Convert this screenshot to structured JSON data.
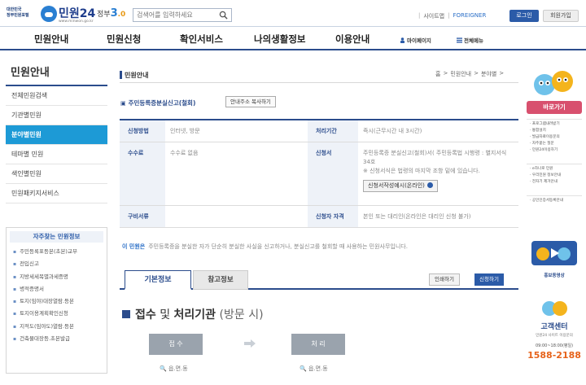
{
  "header": {
    "gov_logo_line1": "대한민국",
    "gov_logo_line2": "정부민원포털",
    "logo_text": "민원24",
    "logo_sub": "www.minwon.go.kr",
    "gov30_prefix": "정부",
    "gov30_num": "3",
    "gov30_suffix": ".0",
    "search_placeholder": "검색어를 입력하세요",
    "sitemap": "사이트맵",
    "foreigner": "FOREIGNER",
    "login": "로그인",
    "signup": "회원가입"
  },
  "gnb": {
    "items": [
      "민원안내",
      "민원신청",
      "확인서비스",
      "나의생활정보",
      "이용안내"
    ],
    "mypage": "마이페이지",
    "allmenu": "전체메뉴"
  },
  "lnb": {
    "title": "민원안내",
    "items": [
      "전체민원검색",
      "기관별민원",
      "분야별민원",
      "테마별 민원",
      "색인별민원",
      "민원패키지서비스"
    ]
  },
  "faq": {
    "title": "자주찾는 민원정보",
    "items": [
      "주민등록표등본(초본)교부",
      "전입신고",
      "지방세세목별과세증명",
      "병적증명서",
      "토지(임야)대장열람.등본",
      "토지이용계획확인신청",
      "지적도(임야도)열람.등본",
      "건축물대장등.초본발급"
    ]
  },
  "content": {
    "page_title": "민원안내",
    "breadcrumb": [
      "홈",
      ">",
      "민원안내",
      ">",
      "분야별",
      ">"
    ],
    "service_title": "주민등록증분실신고(철회)",
    "copy_addr": "안내주소 복사하기",
    "table": {
      "method_label": "신청방법",
      "method_value": "인터넷, 방문",
      "period_label": "처리기간",
      "period_value": "즉시(근무시간 내 3시간)",
      "fee_label": "수수료",
      "fee_value": "수수료 없음",
      "form_label": "신청서",
      "form_value": "주민등록증 분실신고(철회)서( 주민등록법 시행령 : 별지서식 34호",
      "form_note": "※ 신청서식은 법령의 마지막 조항 밑에 있습니다.",
      "apply_btn": "신청서작성예시(온라인)",
      "docs_label": "구비서류",
      "docs_value": "",
      "qual_label": "신청자 자격",
      "qual_value": "본인 또는 대리인(온라인은 대리인 신청 불가)"
    },
    "note_label": "이 민원은",
    "note_text": "주민등록증을 분실한 자가 단순히 분실한 사실을 신고하거나, 분실신고를 철회할 때 사용하는 민원사무입니다.",
    "tab_basic": "기본정보",
    "tab_ref": "참고정보",
    "print": "인쇄하기",
    "apply": "신청하기",
    "section_bold1": "접수",
    "section_mid": " 및 ",
    "section_bold2": "처리기관",
    "section_light": " (방문 시)",
    "step1": "접 수",
    "step2": "처 리",
    "step1_sub": "읍.면.동",
    "step2_sub": "읍.면.동"
  },
  "quick": {
    "title": "바로가기",
    "list1": [
      "프로그램내려받기",
      "통합설치",
      "발급자료이용문의",
      "자주묻는 질문",
      "민원24이용하기"
    ],
    "list2": [
      "e하나로 민원",
      "우리민원 정보안내",
      "전자기 제거안내"
    ],
    "list3": [
      "공인인증서등록안내"
    ],
    "video": "홍보동영상",
    "center_title": "고객센터",
    "center_sub": "민원24 사이트 이용문의",
    "hours": "09:00~18:00(평일)",
    "phone": "1588-2188"
  },
  "colors": {
    "navy": "#2b4c8c",
    "active_blue": "#1d9ad6",
    "phone_orange": "#e6621a",
    "quick_pink": "#d8506e"
  }
}
